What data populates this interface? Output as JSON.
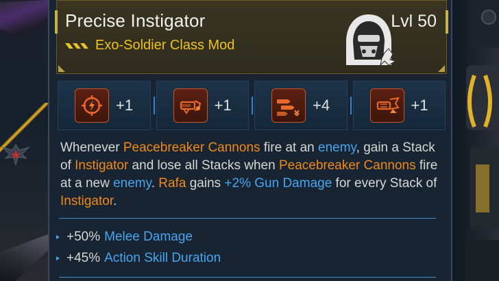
{
  "item": {
    "name": "Precise Instigator",
    "type": "Exo-Soldier Class Mod",
    "level": "Lvl 50",
    "rarity_icon": "triple-chevron-icon",
    "class_icon": "hooded-helmet-icon",
    "rarity_color": "#e7c12e"
  },
  "skills": [
    {
      "icon": "crosshair-lightning-icon",
      "value": "+1"
    },
    {
      "icon": "cannon-icon",
      "value": "+1"
    },
    {
      "icon": "bullets-icon",
      "value": "+4"
    },
    {
      "icon": "cannon-fire-icon",
      "value": "+1"
    }
  ],
  "description": {
    "p1": "Whenever ",
    "k1": "Peacebreaker Cannons",
    "p2": " fire at an ",
    "k2": "enemy",
    "p3": ", gain a Stack of ",
    "k3": "Instigator",
    "p4": " and lose all Stacks when ",
    "k4": "Peacebreaker Cannons",
    "p5": " fire at a new ",
    "k5": "enemy",
    "p6": ". ",
    "k6": "Rafa",
    "p7": " gains ",
    "k7": "+2% Gun Damage",
    "p8": " for every Stack of ",
    "k8": "Instigator",
    "p9": "."
  },
  "bonuses": [
    {
      "value": "+50%",
      "stat": "Melee Damage"
    },
    {
      "value": "+45%",
      "stat": "Action Skill Duration"
    }
  ],
  "colors": {
    "highlight_orange": "#f08a1a",
    "highlight_blue": "#45a6ef",
    "card_bg": "#182432",
    "header_bg": "#3a3420"
  }
}
